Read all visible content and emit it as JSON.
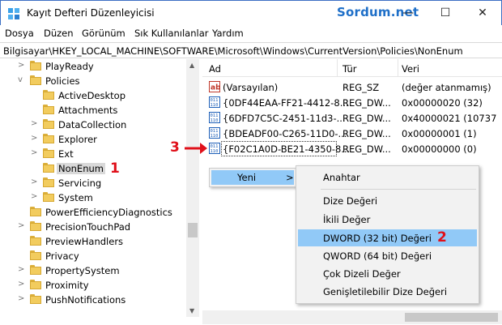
{
  "window": {
    "title": "Kayıt Defteri Düzenleyicisi",
    "watermark": "Sordum.net",
    "minimize": "—",
    "maximize": "☐",
    "close": "✕"
  },
  "menu": [
    "Dosya",
    "Düzen",
    "Görünüm",
    "Sık Kullanılanlar",
    "Yardım"
  ],
  "address": "Bilgisayar\\HKEY_LOCAL_MACHINE\\SOFTWARE\\Microsoft\\Windows\\CurrentVersion\\Policies\\NonEnum",
  "tree": [
    {
      "label": "PlayReady",
      "chevron": ">"
    },
    {
      "label": "Policies",
      "chevron": "v"
    },
    {
      "label": "ActiveDesktop",
      "chevron": ""
    },
    {
      "label": "Attachments",
      "chevron": ""
    },
    {
      "label": "DataCollection",
      "chevron": ">"
    },
    {
      "label": "Explorer",
      "chevron": ">"
    },
    {
      "label": "Ext",
      "chevron": ">"
    },
    {
      "label": "NonEnum",
      "chevron": ""
    },
    {
      "label": "Servicing",
      "chevron": ">"
    },
    {
      "label": "System",
      "chevron": ">"
    },
    {
      "label": "PowerEfficiencyDiagnostics",
      "chevron": ""
    },
    {
      "label": "PrecisionTouchPad",
      "chevron": ">"
    },
    {
      "label": "PreviewHandlers",
      "chevron": ""
    },
    {
      "label": "Privacy",
      "chevron": ""
    },
    {
      "label": "PropertySystem",
      "chevron": ">"
    },
    {
      "label": "Proximity",
      "chevron": ">"
    },
    {
      "label": "PushNotifications",
      "chevron": ">"
    }
  ],
  "columns": {
    "name": "Ad",
    "type": "Tür",
    "data": "Veri"
  },
  "rows": [
    {
      "icon": "string-value-icon",
      "name": "(Varsayılan)",
      "type": "REG_SZ",
      "data": "(değer atanmamış)"
    },
    {
      "icon": "binary-value-icon",
      "name": "{0DF44EAA-FF21-4412-8...",
      "type": "REG_DW...",
      "data": "0x00000020 (32)"
    },
    {
      "icon": "binary-value-icon",
      "name": "{6DFD7C5C-2451-11d3-...",
      "type": "REG_DW...",
      "data": "0x40000021 (10737"
    },
    {
      "icon": "binary-value-icon",
      "name": "{BDEADF00-C265-11D0-...",
      "type": "REG_DW...",
      "data": "0x00000001 (1)"
    },
    {
      "icon": "binary-value-icon",
      "name": "{F02C1A0D-BE21-4350-8...",
      "type": "REG_DW...",
      "data": "0x00000000 (0)"
    }
  ],
  "context_menu": {
    "new_label": "Yeni",
    "new_arrow": ">",
    "submenu": [
      "Anahtar",
      "Dize Değeri",
      "İkili Değer",
      "DWORD (32 bit) Değeri",
      "QWORD (64 bit) Değeri",
      "Çok Dizeli Değer",
      "Genişletilebilir Dize Değeri"
    ]
  },
  "annotations": {
    "one": "1",
    "two": "2",
    "three": "3"
  },
  "colors": {
    "accent": "#91c9f7",
    "annotation": "#e0101a",
    "watermark": "#1e6fc8",
    "folder": "#f2cc5e"
  }
}
